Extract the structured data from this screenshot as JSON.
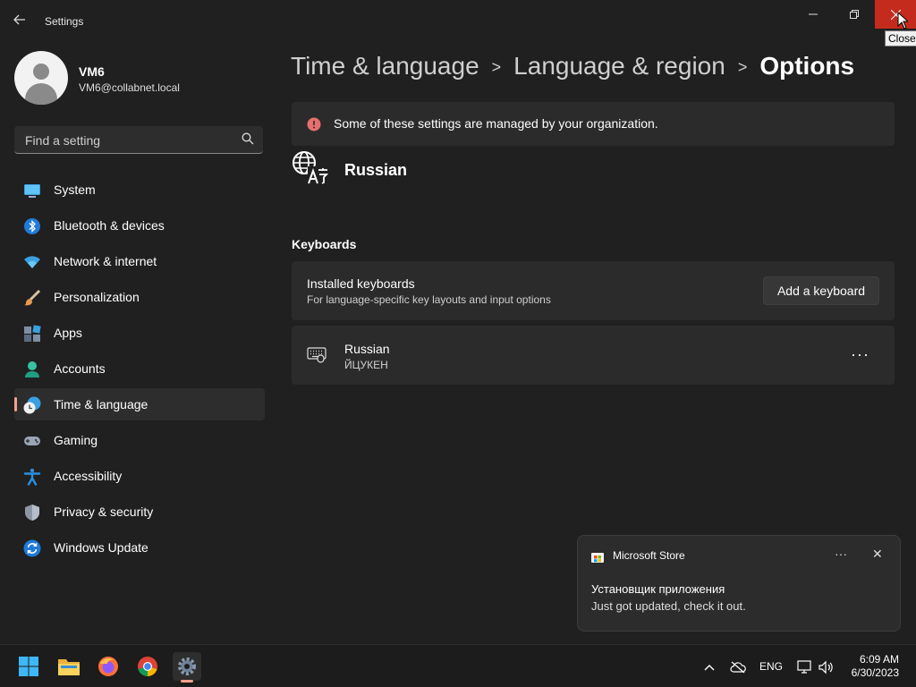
{
  "window": {
    "title": "Settings",
    "back_icon": "back-arrow-icon",
    "minimize_icon": "minimize-icon",
    "maximize_icon": "restore-icon",
    "close_icon": "close-icon",
    "close_tooltip": "Close"
  },
  "user": {
    "name": "VM6",
    "email": "VM6@collabnet.local"
  },
  "search": {
    "placeholder": "Find a setting"
  },
  "sidebar": {
    "items": [
      {
        "label": "System",
        "icon": "system-icon"
      },
      {
        "label": "Bluetooth & devices",
        "icon": "bluetooth-icon"
      },
      {
        "label": "Network & internet",
        "icon": "wifi-icon"
      },
      {
        "label": "Personalization",
        "icon": "brush-icon"
      },
      {
        "label": "Apps",
        "icon": "apps-icon"
      },
      {
        "label": "Accounts",
        "icon": "accounts-icon"
      },
      {
        "label": "Time & language",
        "icon": "time-language-icon",
        "selected": true
      },
      {
        "label": "Gaming",
        "icon": "gamepad-icon"
      },
      {
        "label": "Accessibility",
        "icon": "accessibility-icon"
      },
      {
        "label": "Privacy & security",
        "icon": "shield-icon"
      },
      {
        "label": "Windows Update",
        "icon": "update-icon"
      }
    ]
  },
  "breadcrumb": {
    "items": [
      "Time & language",
      "Language & region",
      "Options"
    ]
  },
  "banner": {
    "text": "Some of these settings are managed by your organization.",
    "icon": "info-warning-icon"
  },
  "language": {
    "name": "Russian",
    "icon": "language-icon"
  },
  "keyboards": {
    "section_title": "Keyboards",
    "installed_title": "Installed keyboards",
    "installed_sub": "For language-specific key layouts and input options",
    "add_button": "Add a keyboard",
    "items": [
      {
        "name": "Russian",
        "layout": "ЙЦУКЕН",
        "more": "···"
      }
    ]
  },
  "toast": {
    "app": "Microsoft Store",
    "title": "Установщик приложения",
    "body": "Just got updated, check it out.",
    "more": "···",
    "close": "✕"
  },
  "taskbar": {
    "apps": [
      "start-icon",
      "file-explorer-icon",
      "firefox-icon",
      "chrome-icon",
      "settings-icon"
    ],
    "language": "ENG",
    "time": "6:09 AM",
    "date": "6/30/2023"
  },
  "colors": {
    "accent": "#f4a38c",
    "close_hover": "#c42b1c",
    "banner_icon": "#e86f6f"
  }
}
